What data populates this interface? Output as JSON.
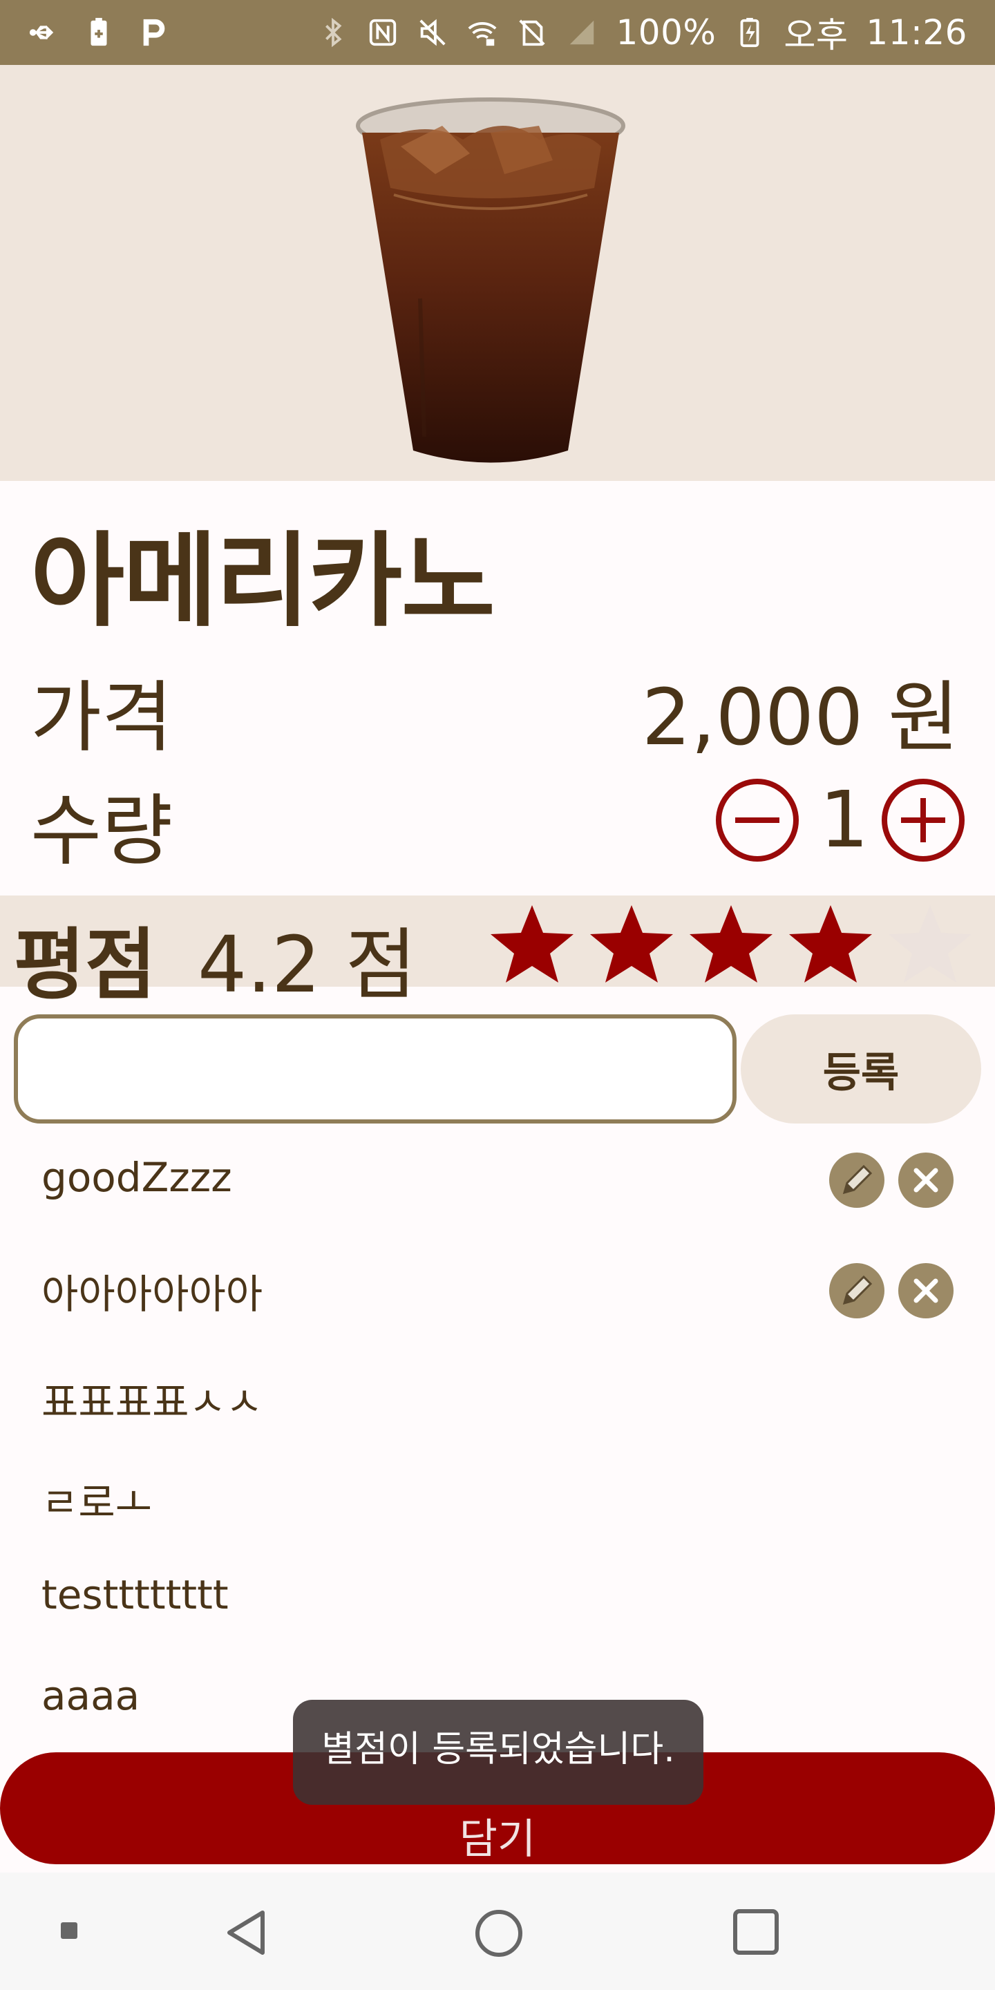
{
  "status_bar": {
    "battery": "100%",
    "ampm": "오후",
    "time": "11:26",
    "background_color": "#8f7c57",
    "left_icons": [
      "usb-icon",
      "battery-saver-icon",
      "p-icon"
    ],
    "right_icons": [
      "bluetooth-icon",
      "nfc-icon",
      "mute-icon",
      "wifi-icon",
      "no-sim-icon",
      "signal-icon",
      "battery-icon"
    ]
  },
  "product": {
    "name": "아메리카노",
    "image_icon": "iced-americano-image"
  },
  "price": {
    "label": "가격",
    "value": "2,000 원"
  },
  "quantity": {
    "label": "수량",
    "value": "1"
  },
  "rating": {
    "label": "평점",
    "value": "4.2 점",
    "stars_filled": 4,
    "stars_total": 5,
    "filled_color": "#9a0000",
    "empty_color": "#ece2dd"
  },
  "review_form": {
    "input_value": "",
    "placeholder": "",
    "submit_label": "등록"
  },
  "reviews": [
    {
      "text": "goodZzzz",
      "editable": true
    },
    {
      "text": "아아아아아아",
      "editable": true
    },
    {
      "text": "표표표표ㅅㅅ",
      "editable": false
    },
    {
      "text": "ㄹ로ㅗ",
      "editable": false
    },
    {
      "text": "testttttttt",
      "editable": false
    },
    {
      "text": "aaaa",
      "editable": false
    }
  ],
  "toast": {
    "message": "별점이 등록되었습니다."
  },
  "bottom_button": {
    "label": "담기",
    "color": "#9a0000"
  },
  "nav_bar": {
    "icons": [
      "recents-dot-icon",
      "back-icon",
      "home-icon",
      "overview-icon"
    ]
  }
}
